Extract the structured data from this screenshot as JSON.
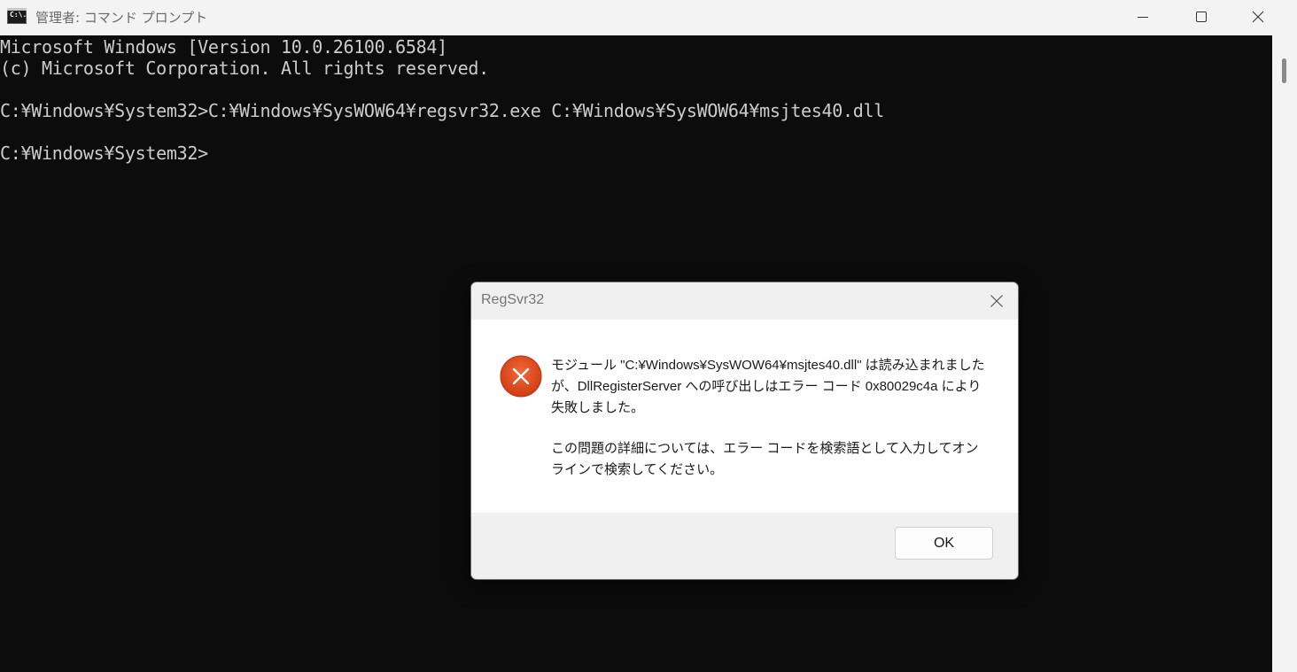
{
  "window": {
    "title": "管理者: コマンド プロンプト",
    "icon": "cmd-icon",
    "icon_text": "C:\\.",
    "controls": [
      "minimize-icon",
      "maximize-icon",
      "close-icon"
    ]
  },
  "terminal": {
    "lines": [
      "Microsoft Windows [Version 10.0.26100.6584]",
      "(c) Microsoft Corporation. All rights reserved.",
      "",
      "C:¥Windows¥System32>C:¥Windows¥SysWOW64¥regsvr32.exe C:¥Windows¥SysWOW64¥msjtes40.dll",
      "",
      "C:¥Windows¥System32>"
    ],
    "text_color": "#cccccc",
    "background": "#0c0c0c"
  },
  "dialog": {
    "title": "RegSvr32",
    "icon": "error-icon",
    "icon_color": "#e0461f",
    "message_1": "モジュール \"C:¥Windows¥SysWOW64¥msjtes40.dll\" は読み込まれましたが、DllRegisterServer への呼び出しはエラー コード 0x80029c4a により失敗しました。",
    "message_2": "この問題の詳細については、エラー コードを検索語として入力してオンラインで検索してください。",
    "ok_label": "OK"
  }
}
